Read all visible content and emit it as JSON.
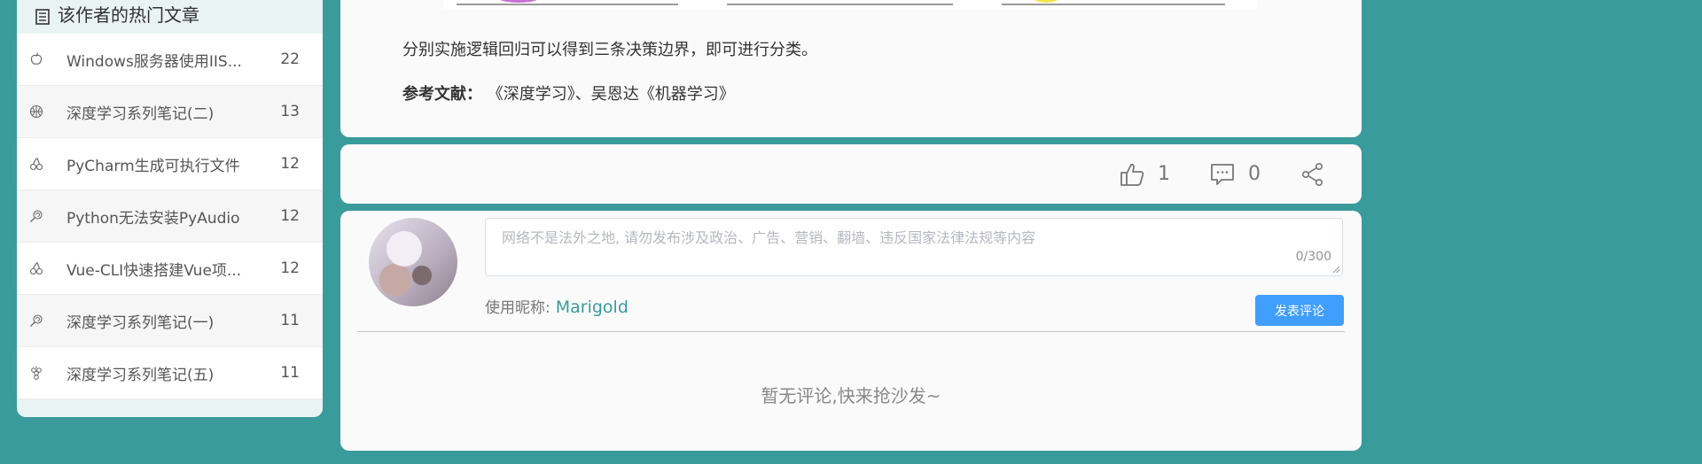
{
  "sidebar": {
    "title": "该作者的热门文章",
    "articles": [
      {
        "title": "Windows服务器使用IIS...",
        "count": "22",
        "icon": "apple-icon"
      },
      {
        "title": "深度学习系列笔记(二)",
        "count": "13",
        "icon": "basketball-icon"
      },
      {
        "title": "PyCharm生成可执行文件",
        "count": "12",
        "icon": "cherry-icon"
      },
      {
        "title": "Python无法安装PyAudio",
        "count": "12",
        "icon": "lollipop-icon"
      },
      {
        "title": "Vue-CLI快速搭建Vue项...",
        "count": "12",
        "icon": "cherry-icon"
      },
      {
        "title": "深度学习系列笔记(一)",
        "count": "11",
        "icon": "lollipop-icon"
      },
      {
        "title": "深度学习系列笔记(五)",
        "count": "11",
        "icon": "grape-icon"
      }
    ]
  },
  "article": {
    "conclusion": "分别实施逻辑回归可以得到三条决策边界，即可进行分类。",
    "ref_label": "参考文献：",
    "ref_text": "《深度学习》、吴恩达《机器学习》"
  },
  "actions": {
    "likes": "1",
    "comments": "0"
  },
  "comment": {
    "placeholder": "网络不是法外之地, 请勿发布涉及政治、广告、营销、翻墙、违反国家法律法规等内容",
    "word_count": "0/300",
    "nickname_label": "使用昵称:",
    "nickname": "Marigold",
    "submit_label": "发表评论",
    "empty_tip": "暂无评论,快来抢沙发~"
  },
  "colors": {
    "background": "#3a9b9c",
    "accent": "#409eff",
    "nickname": "#3a9b9c"
  }
}
